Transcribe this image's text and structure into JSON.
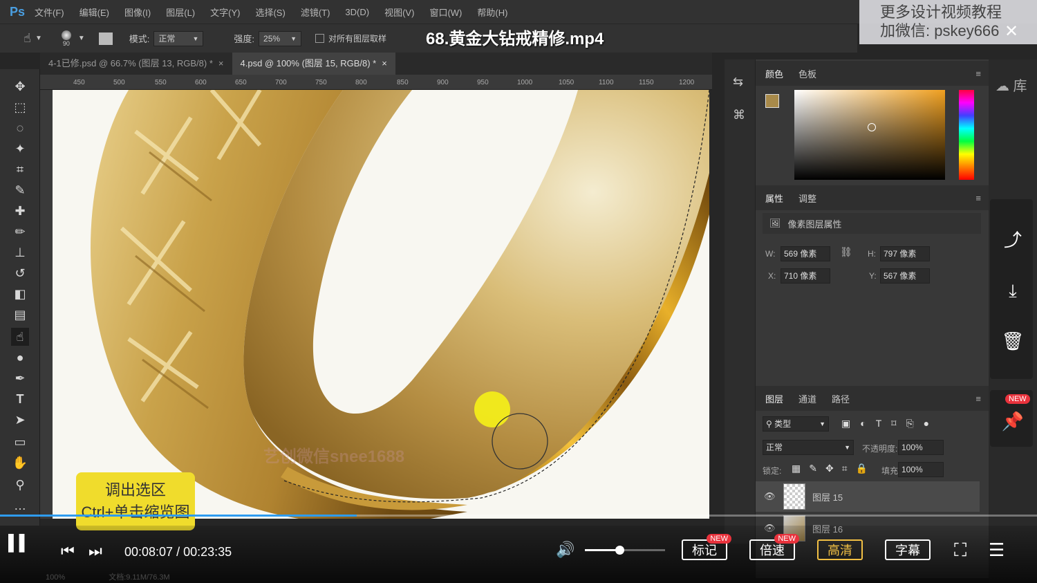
{
  "menubar": {
    "logo": "Ps",
    "items": [
      "文件(F)",
      "编辑(E)",
      "图像(I)",
      "图层(L)",
      "文字(Y)",
      "选择(S)",
      "滤镜(T)",
      "3D(D)",
      "视图(V)",
      "窗口(W)",
      "帮助(H)"
    ]
  },
  "options": {
    "brush_size": "90",
    "mode_label": "模式:",
    "mode_value": "正常",
    "strength_label": "强度:",
    "strength_value": "25%",
    "sample_all_label": "对所有图层取样"
  },
  "video_title": "68.黄金大钻戒精修.mp4",
  "watermark": {
    "line1": "更多设计视频教程",
    "line2": "加微信: pskey666"
  },
  "tabs": [
    {
      "label": "4-1已修.psd @ 66.7% (图层 13, RGB/8) *",
      "close": "×"
    },
    {
      "label": "4.psd @ 100% (图层 15, RGB/8) *",
      "close": "×"
    }
  ],
  "ruler": {
    "marks": [
      "450",
      "500",
      "550",
      "600",
      "650",
      "700",
      "750",
      "800",
      "850",
      "900",
      "950",
      "1000",
      "1050",
      "1100",
      "1150",
      "1200"
    ]
  },
  "canvas": {
    "watermark_text": "艺创微信snee1688"
  },
  "color_panel": {
    "tabs": [
      "颜色",
      "色板"
    ],
    "fg_color": "#a88a4a",
    "bg_color": "#ffffff",
    "hue_color": "#f0a020"
  },
  "properties_panel": {
    "tabs": [
      "属性",
      "调整"
    ],
    "subtitle": "像素图层属性",
    "w_label": "W:",
    "w_value": "569 像素",
    "h_label": "H:",
    "h_value": "797 像素",
    "x_label": "X:",
    "x_value": "710 像素",
    "y_label": "Y:",
    "y_value": "567 像素"
  },
  "layers_panel": {
    "tabs": [
      "图层",
      "通道",
      "路径"
    ],
    "filter_label": "类型",
    "blend_mode": "正常",
    "opacity_label": "不透明度:",
    "opacity_value": "100%",
    "lock_label": "锁定:",
    "fill_label": "填充:",
    "fill_value": "100%",
    "layers": [
      {
        "name": "图层 15",
        "visible": true,
        "selected": true
      },
      {
        "name": "图层 16",
        "visible": true,
        "selected": false
      }
    ]
  },
  "hint": {
    "line1": "调出选区",
    "line2": "Ctrl+单击缩览图"
  },
  "player": {
    "current_time": "00:08:07",
    "separator": "/",
    "total_time": "00:23:35",
    "progress": 0.344,
    "volume": 0.43,
    "mark_label": "标记",
    "speed_label": "倍速",
    "quality_label": "高清",
    "subtitle_label": "字幕",
    "new_badge": "NEW"
  },
  "status": {
    "zoom": "100%",
    "doc_info": "文档:9.11M/76.3M"
  },
  "side_actions": {
    "new_badge": "NEW"
  }
}
